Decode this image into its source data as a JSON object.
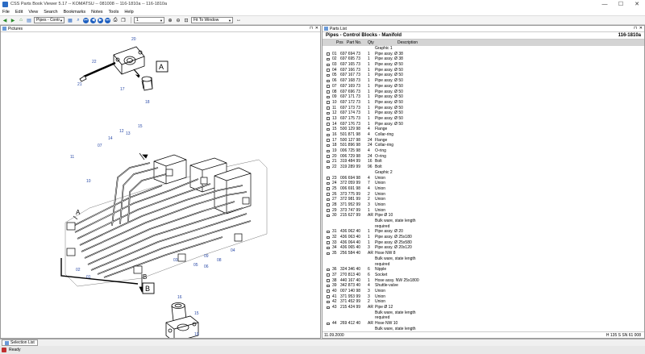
{
  "window": {
    "title": "CSS Parts Book Viewer 5.17 -- KOMATSU -- 081008 -- 116-1810a -- 116-1810a",
    "controls": [
      "—",
      "☐",
      "✕"
    ]
  },
  "menu": [
    "File",
    "Edit",
    "View",
    "Search",
    "Bookmarks",
    "Notes",
    "Tools",
    "Help"
  ],
  "toolbar": {
    "book_combo": "Pipes - Contr",
    "page_value": "1",
    "zoom_value": "Fit To Window"
  },
  "pictures_panel": {
    "title": "Pictures"
  },
  "parts_panel": {
    "tab_title": "Parts List",
    "list_title": "Pipes - Control Blocks - Manifold",
    "list_number": "116-1810a",
    "columns": [
      "Pos",
      "Part No.",
      "Qty",
      "Description"
    ],
    "rows": [
      {
        "pos": "",
        "part": "",
        "qty": "",
        "desc": "Graphic 1",
        "chk": false
      },
      {
        "pos": "01",
        "part": "697 694 73",
        "qty": "1",
        "desc": "Pipe assy. Ø 38",
        "chk": true
      },
      {
        "pos": "02",
        "part": "697 695 73",
        "qty": "1",
        "desc": "Pipe assy. Ø 38",
        "chk": true
      },
      {
        "pos": "03",
        "part": "697 165 73",
        "qty": "1",
        "desc": "Pipe assy. Ø 50",
        "chk": true
      },
      {
        "pos": "04",
        "part": "697 166 73",
        "qty": "1",
        "desc": "Pipe assy. Ø 50",
        "chk": true
      },
      {
        "pos": "05",
        "part": "697 167 73",
        "qty": "1",
        "desc": "Pipe assy. Ø 50",
        "chk": true
      },
      {
        "pos": "06",
        "part": "697 168 73",
        "qty": "1",
        "desc": "Pipe assy. Ø 50",
        "chk": true
      },
      {
        "pos": "07",
        "part": "697 169 73",
        "qty": "1",
        "desc": "Pipe assy. Ø 50",
        "chk": true
      },
      {
        "pos": "08",
        "part": "697 696 73",
        "qty": "1",
        "desc": "Pipe assy. Ø 50",
        "chk": true
      },
      {
        "pos": "09",
        "part": "697 171 73",
        "qty": "1",
        "desc": "Pipe assy. Ø 50",
        "chk": true
      },
      {
        "pos": "10",
        "part": "697 172 73",
        "qty": "1",
        "desc": "Pipe assy. Ø 50",
        "chk": true
      },
      {
        "pos": "11",
        "part": "697 173 73",
        "qty": "1",
        "desc": "Pipe assy. Ø 50",
        "chk": true
      },
      {
        "pos": "12",
        "part": "697 174 73",
        "qty": "1",
        "desc": "Pipe assy. Ø 50",
        "chk": true
      },
      {
        "pos": "13",
        "part": "697 175 73",
        "qty": "1",
        "desc": "Pipe assy. Ø 50",
        "chk": true
      },
      {
        "pos": "14",
        "part": "697 176 73",
        "qty": "1",
        "desc": "Pipe assy. Ø 50",
        "chk": true
      },
      {
        "pos": "15",
        "part": "500 129 98",
        "qty": "4",
        "desc": "Flange",
        "chk": true
      },
      {
        "pos": "16",
        "part": "501 871 98",
        "qty": "4",
        "desc": "Collar-ring",
        "chk": true
      },
      {
        "pos": "17",
        "part": "500 127 98",
        "qty": "24",
        "desc": "Flange",
        "chk": true
      },
      {
        "pos": "18",
        "part": "501 896 98",
        "qty": "24",
        "desc": "Collar-ring",
        "chk": true
      },
      {
        "pos": "19",
        "part": "006 725 98",
        "qty": "4",
        "desc": "O-ring",
        "chk": true
      },
      {
        "pos": "20",
        "part": "006 729 98",
        "qty": "24",
        "desc": "O-ring",
        "chk": true
      },
      {
        "pos": "21",
        "part": "319 484 99",
        "qty": "16",
        "desc": "Bolt",
        "chk": true
      },
      {
        "pos": "22",
        "part": "319 289 99",
        "qty": "96",
        "desc": "Bolt",
        "chk": true
      },
      {
        "pos": "",
        "part": "",
        "qty": "",
        "desc": "Graphic 2",
        "chk": false
      },
      {
        "pos": "23",
        "part": "006 694 98",
        "qty": "4",
        "desc": "Union",
        "chk": true
      },
      {
        "pos": "24",
        "part": "372 059 99",
        "qty": "7",
        "desc": "Union",
        "chk": true
      },
      {
        "pos": "25",
        "part": "006 691 98",
        "qty": "4",
        "desc": "Union",
        "chk": true
      },
      {
        "pos": "26",
        "part": "373 775 99",
        "qty": "2",
        "desc": "Union",
        "chk": true
      },
      {
        "pos": "27",
        "part": "372 981 99",
        "qty": "2",
        "desc": "Union",
        "chk": true
      },
      {
        "pos": "28",
        "part": "371 952 99",
        "qty": "3",
        "desc": "Union",
        "chk": true
      },
      {
        "pos": "29",
        "part": "373 747 99",
        "qty": "1",
        "desc": "Union",
        "chk": true
      },
      {
        "pos": "30",
        "part": "215 627 99",
        "qty": "AR",
        "desc": "Pipe Ø 10",
        "chk": true
      },
      {
        "pos": "",
        "part": "",
        "qty": "",
        "desc": "Bulk ware, state length",
        "chk": false
      },
      {
        "pos": "",
        "part": "",
        "qty": "",
        "desc": "required",
        "chk": false
      },
      {
        "pos": "31",
        "part": "436 062 40",
        "qty": "1",
        "desc": "Pipe assy. Ø 20",
        "chk": true
      },
      {
        "pos": "32",
        "part": "436 063 40",
        "qty": "1",
        "desc": "Pipe assy. Ø 25x180",
        "chk": true
      },
      {
        "pos": "33",
        "part": "436 064 40",
        "qty": "1",
        "desc": "Pipe assy. Ø 25x580",
        "chk": true
      },
      {
        "pos": "34",
        "part": "436 065 40",
        "qty": "3",
        "desc": "Pipe assy. Ø 20x120",
        "chk": true
      },
      {
        "pos": "35",
        "part": "256 584 40",
        "qty": "AR",
        "desc": "Hose NW 8",
        "chk": true
      },
      {
        "pos": "",
        "part": "",
        "qty": "",
        "desc": "Bulk ware, state length",
        "chk": false
      },
      {
        "pos": "",
        "part": "",
        "qty": "",
        "desc": "required",
        "chk": false
      },
      {
        "pos": "36",
        "part": "324 346 40",
        "qty": "6",
        "desc": "Nipple",
        "chk": true
      },
      {
        "pos": "37",
        "part": "270 813 40",
        "qty": "6",
        "desc": "Socket",
        "chk": true
      },
      {
        "pos": "38",
        "part": "440 167 40",
        "qty": "1",
        "desc": "Hose assy. NW 25x1800",
        "chk": true
      },
      {
        "pos": "39",
        "part": "342 873 40",
        "qty": "4",
        "desc": "Shuttle-valve",
        "chk": true
      },
      {
        "pos": "40",
        "part": "007 140 98",
        "qty": "3",
        "desc": "Union",
        "chk": true
      },
      {
        "pos": "41",
        "part": "371 953 99",
        "qty": "3",
        "desc": "Union",
        "chk": true
      },
      {
        "pos": "42",
        "part": "371 452 99",
        "qty": "2",
        "desc": "Union",
        "chk": true
      },
      {
        "pos": "43",
        "part": "215 424 99",
        "qty": "AR",
        "desc": "Pipe Ø 12",
        "chk": true
      },
      {
        "pos": "",
        "part": "",
        "qty": "",
        "desc": "Bulk ware, state length",
        "chk": false
      },
      {
        "pos": "",
        "part": "",
        "qty": "",
        "desc": "required",
        "chk": false
      },
      {
        "pos": "44",
        "part": "269 412 40",
        "qty": "AR",
        "desc": "Hose NW 10",
        "chk": true
      },
      {
        "pos": "",
        "part": "",
        "qty": "",
        "desc": "Bulk ware, state length",
        "chk": false
      }
    ],
    "footer_left": "11.09.2000",
    "footer_right": "H 135 S SN 61 008"
  },
  "drawing": {
    "view_a_label": "A",
    "view_b_label": "B",
    "main_a_label": "A",
    "main_b_label": "B",
    "callouts_a": [
      "20",
      "22",
      "17",
      "18",
      "21"
    ],
    "callouts_main": [
      "15",
      "13",
      "12",
      "14",
      "07",
      "11",
      "10",
      "03",
      "09",
      "05",
      "06",
      "08",
      "04",
      "01",
      "02"
    ],
    "callouts_b": [
      "16",
      "15",
      "19",
      "21"
    ]
  },
  "bottom_tab": "Selection List",
  "status": "Ready"
}
